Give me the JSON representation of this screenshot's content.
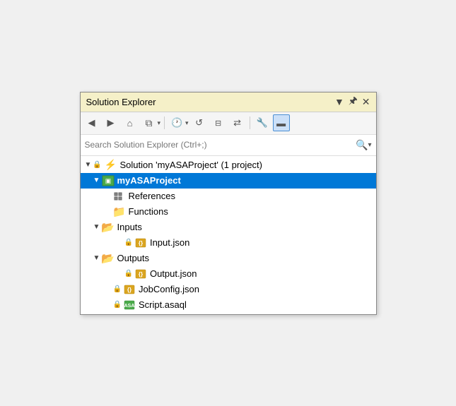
{
  "window": {
    "title": "Solution Explorer",
    "title_icon": "▼",
    "pin_icon": "📌",
    "close_icon": "✕"
  },
  "toolbar": {
    "back_label": "◀",
    "forward_label": "▶",
    "home_label": "⌂",
    "copy_label": "📋",
    "refresh_label": "↺",
    "collapse_label": "⤒",
    "sync_label": "⇄",
    "wrench_label": "🔧",
    "panel_label": "▬"
  },
  "search": {
    "placeholder": "Search Solution Explorer (Ctrl+;)"
  },
  "tree": {
    "solution_label": "Solution 'myASAProject' (1 project)",
    "project_label": "myASAProject",
    "references_label": "References",
    "functions_label": "Functions",
    "inputs_label": "Inputs",
    "input_json_label": "Input.json",
    "outputs_label": "Outputs",
    "output_json_label": "Output.json",
    "jobconfig_label": "JobConfig.json",
    "script_label": "Script.asaql"
  }
}
